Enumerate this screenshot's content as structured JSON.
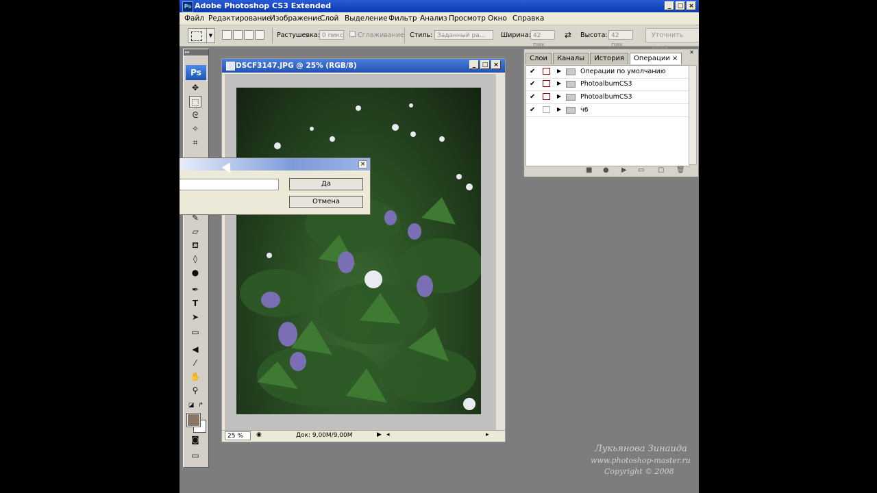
{
  "app": {
    "title": "Adobe Photoshop CS3 Extended",
    "icon_text": "Ps"
  },
  "menu": [
    "Файл",
    "Редактирование",
    "Изображение",
    "Слой",
    "Выделение",
    "Фильтр",
    "Анализ",
    "Просмотр",
    "Окно",
    "Справка"
  ],
  "options": {
    "feather_label": "Растушевка:",
    "feather_value": "0 пикс",
    "antialias_label": "Сглаживание",
    "style_label": "Стиль:",
    "style_value": "Заданный ра...",
    "width_label": "Ширина:",
    "width_value": "42 пик",
    "height_label": "Высота:",
    "height_value": "42 пик",
    "refine_label": "Уточнить край"
  },
  "toolbox": {
    "logo": "Ps"
  },
  "document": {
    "title": "DSCF3147.JPG @ 25% (RGB/8)",
    "zoom": "25 %",
    "doc_info": "Док: 9,00M/9,00M"
  },
  "panel": {
    "tabs": [
      "Слои",
      "Каналы",
      "История",
      "Операции"
    ],
    "active_tab": "Операции",
    "close_glyph": "×",
    "rows": [
      {
        "checked": true,
        "dialog": true,
        "label": "Операции по умолчанию"
      },
      {
        "checked": true,
        "dialog": true,
        "label": "PhotoalbumCS3"
      },
      {
        "checked": true,
        "dialog": true,
        "label": "PhotoalbumCS3"
      },
      {
        "checked": true,
        "dialog": false,
        "label": "ч6"
      }
    ]
  },
  "dialog": {
    "ok_label": "Да",
    "cancel_label": "Отмена",
    "close_glyph": "×"
  },
  "watermark": {
    "author": "Лукьянова Зинаида",
    "site": "www.photoshop-master.ru",
    "copyright": "Copyright © 2008"
  }
}
